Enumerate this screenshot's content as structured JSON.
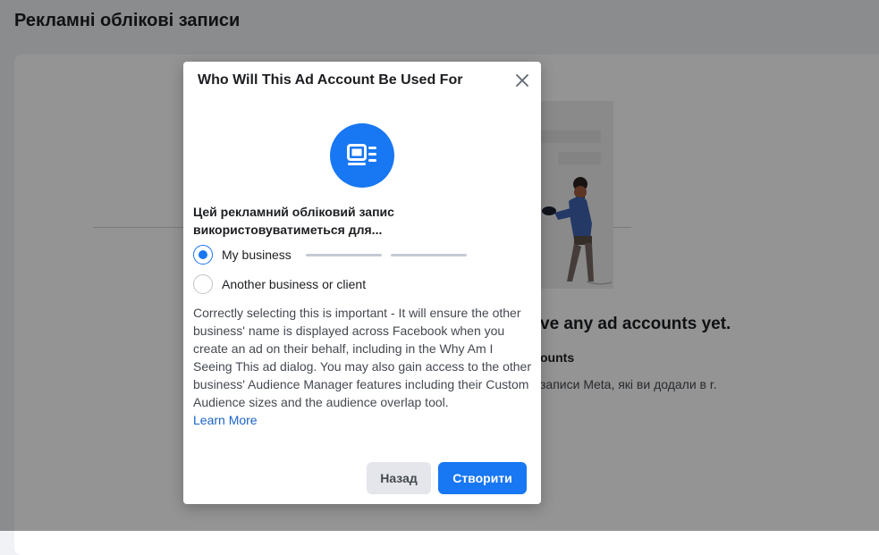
{
  "page": {
    "title": "Рекламні облікові записи",
    "empty_title": "ve any ad accounts yet.",
    "section_title": "ounts",
    "section_desc": "записи Meta, які ви додали в r."
  },
  "dialog": {
    "title": "Who Will This Ad Account Be Used For",
    "hero_icon": "ad-preview-icon",
    "question": "Цей рекламний обліковий запис використовуватиметься для...",
    "options": [
      {
        "label": "My business",
        "selected": true
      },
      {
        "label": "Another business or client",
        "selected": false
      }
    ],
    "info_text": "Correctly selecting this is important - It will ensure the other business' name is displayed across Facebook when you create an ad on their behalf, including in the Why Am I Seeing This ad dialog. You may also gain access to the other business' Audience Manager features including their Custom Audience sizes and the audience overlap tool.",
    "learn_more": "Learn More",
    "back_button": "Назад",
    "create_button": "Створити"
  },
  "colors": {
    "accent": "#1877f2",
    "link": "#1b63c7",
    "overlay": "rgba(0,0,0,0.42)"
  }
}
